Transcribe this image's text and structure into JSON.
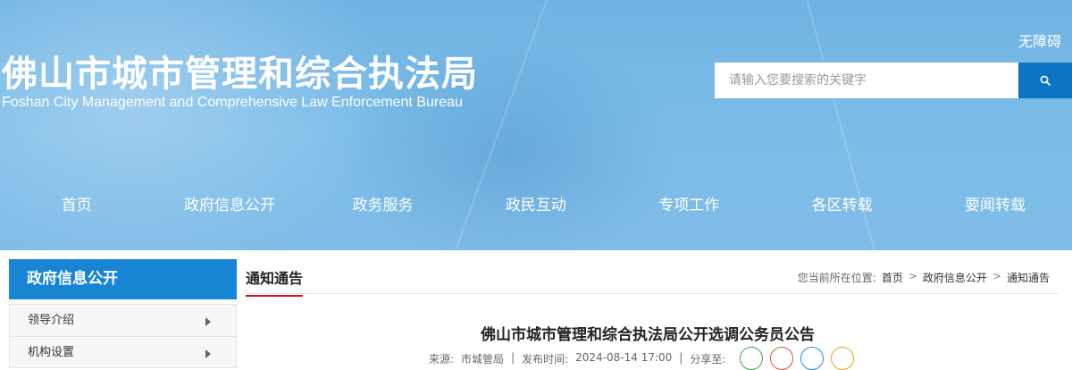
{
  "header": {
    "title": "佛山市城市管理和综合执法局",
    "subtitle": "Foshan City Management and Comprehensive Law Enforcement Bureau",
    "accessibility_label": "无障碍",
    "search": {
      "placeholder": "请输入您要搜索的关键字",
      "value": "",
      "icon": "search-icon"
    }
  },
  "nav": {
    "items": [
      {
        "label": "首页"
      },
      {
        "label": "政府信息公开"
      },
      {
        "label": "政务服务"
      },
      {
        "label": "政民互动"
      },
      {
        "label": "专项工作"
      },
      {
        "label": "各区转载"
      },
      {
        "label": "要闻转载"
      }
    ]
  },
  "sidebar": {
    "title": "政府信息公开",
    "items": [
      {
        "label": "领导介绍"
      },
      {
        "label": "机构设置"
      }
    ]
  },
  "main": {
    "section_title": "通知通告",
    "breadcrumb": {
      "prefix": "您当前所在位置:",
      "items": [
        {
          "label": "首页"
        },
        {
          "label": "政府信息公开"
        },
        {
          "label": "通知通告"
        }
      ],
      "separator": ">"
    },
    "article": {
      "title": "佛山市城市管理和综合执法局公开选调公务员公告",
      "source_label": "来源:",
      "source": "市城管局",
      "published_label": "发布时间:",
      "published": "2024-08-14 17:00",
      "share_label": "分享至:"
    }
  },
  "colors": {
    "accent_blue": "#1784d4",
    "search_button": "#0b74c4",
    "tab_underline": "#c8161d",
    "share_icons": [
      "#3aa64a",
      "#e0533c",
      "#2a8ad8",
      "#f0a020"
    ]
  }
}
